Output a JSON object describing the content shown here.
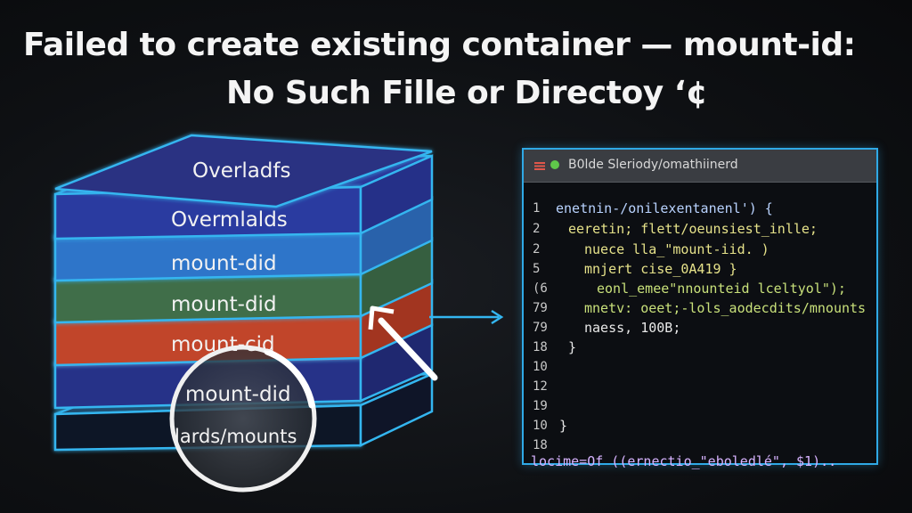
{
  "title": {
    "line1": "Failed to create existing container — mount-id:",
    "line2": "No Such Fille or Directoy ‘¢"
  },
  "stack": {
    "layers": [
      {
        "label": "Overladfs",
        "color": "#2c3382"
      },
      {
        "label": "Overmlalds",
        "color": "#2c3aa0"
      },
      {
        "label": "mount-did",
        "color": "#2f74c9"
      },
      {
        "label": "mount-did",
        "color": "#3f6e4a"
      },
      {
        "label": "mount-cid",
        "color": "#c1442c"
      },
      {
        "label": "mount-did",
        "color": "#2c3590"
      },
      {
        "label": "lards/mounts",
        "color": "#1a1f3a"
      }
    ],
    "edge_color": "#34b6f0"
  },
  "code_panel": {
    "title": "B0lde Sleriody/omathiinerd",
    "lines": [
      {
        "n": "1",
        "text": "enetnin-/onilexentanenl') {",
        "color": "c-blue"
      },
      {
        "n": "2",
        "text": "eeretin; flett/oeunsiest_inlle;",
        "color": "c-yellow"
      },
      {
        "n": "2",
        "text": "nuece  lla_\"mount-iid. )",
        "color": "c-yellow"
      },
      {
        "n": "5",
        "text": "mnjert  cise_0A419 }",
        "color": "c-yellow"
      },
      {
        "n": "(6",
        "text": "eonl_emee\"nnounteid lceltyol\");",
        "color": "c-green"
      },
      {
        "n": "79",
        "text": "mnetv: oeet;-lols_aodecdits/mnounts",
        "color": "c-green"
      },
      {
        "n": "79",
        "text": "naess, 100B;",
        "color": "c-white"
      },
      {
        "n": "18",
        "text": "}",
        "color": "c-white"
      },
      {
        "n": "10",
        "text": "",
        "color": "c-white"
      },
      {
        "n": "12",
        "text": "",
        "color": "c-white"
      },
      {
        "n": "19",
        "text": "",
        "color": "c-white"
      },
      {
        "n": "10",
        "text": "}",
        "color": "c-white"
      },
      {
        "n": "18",
        "text": "",
        "color": "c-white"
      },
      {
        "n": "",
        "text": "locime=Of ((ernectio_\"eboledlé\", $1)..",
        "color": "c-purple"
      }
    ]
  }
}
